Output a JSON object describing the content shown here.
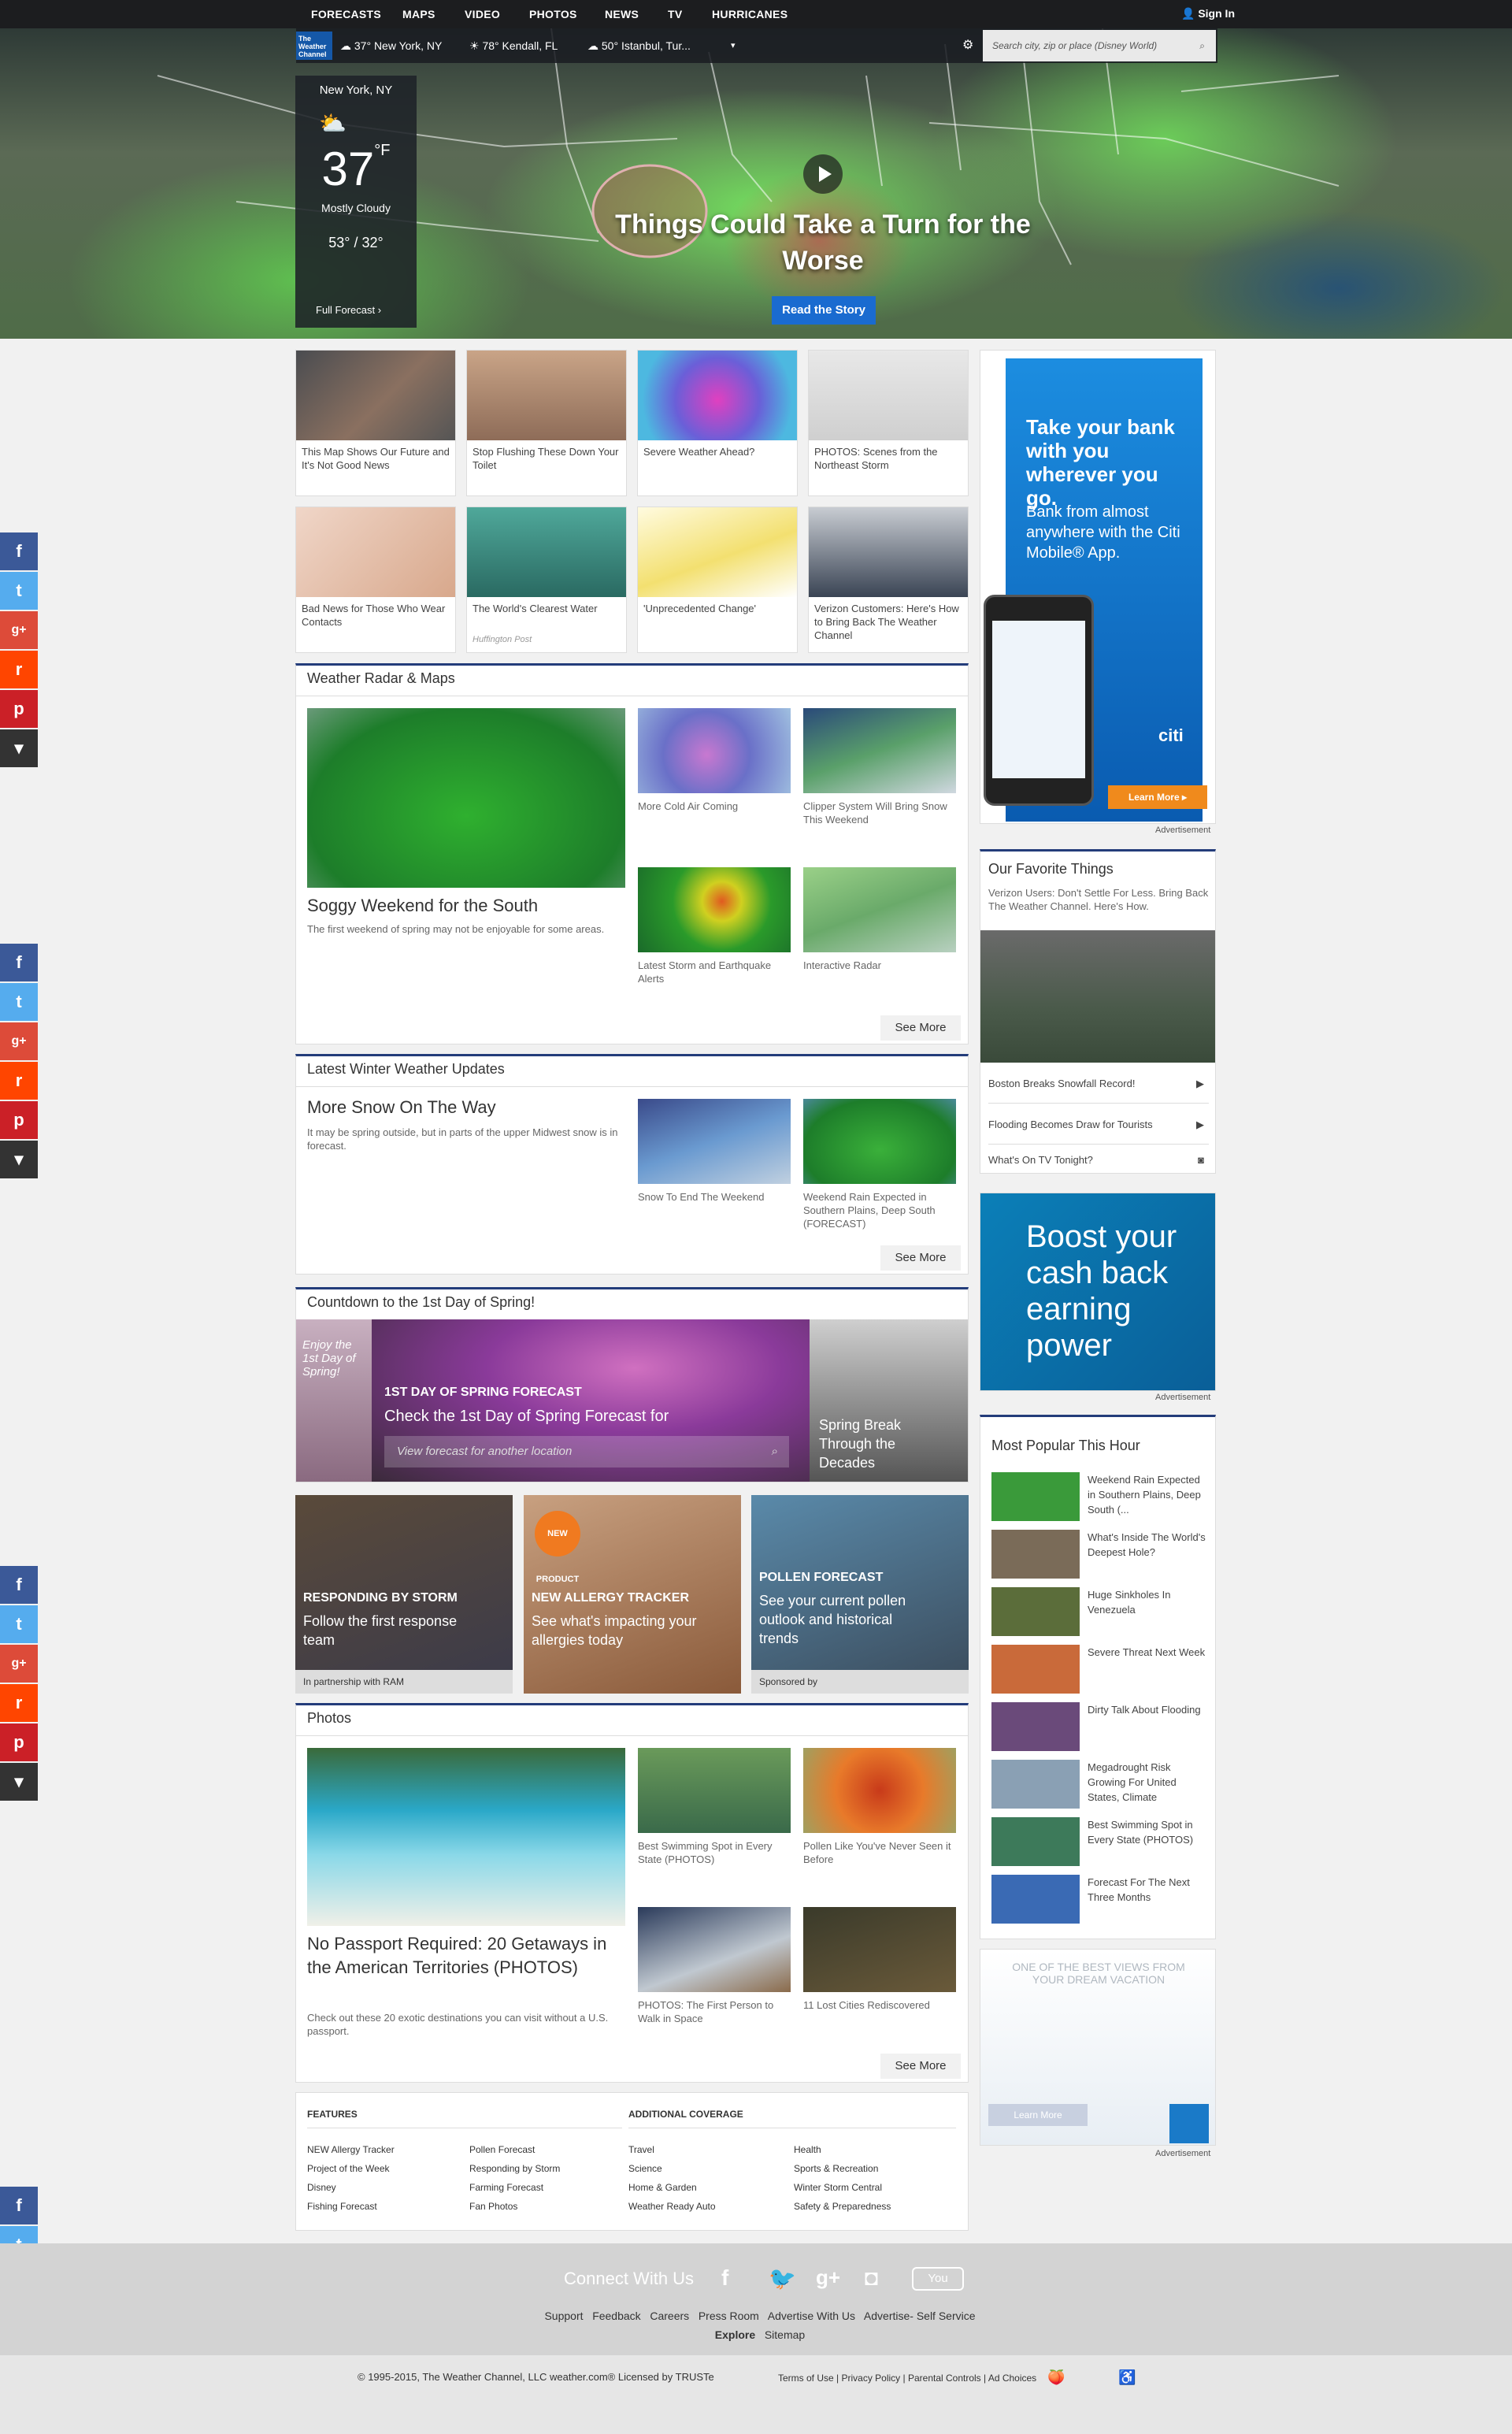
{
  "nav": {
    "items": [
      "FORECASTS",
      "MAPS",
      "VIDEO",
      "PHOTOS",
      "NEWS",
      "TV",
      "HURRICANES"
    ],
    "signin": "Sign In"
  },
  "locbar": {
    "logo": "The Weather Channel",
    "locations": [
      {
        "temp": "37° New York, NY",
        "icon": "cloud-icon"
      },
      {
        "temp": "78° Kendall, FL",
        "icon": "sun-icon"
      },
      {
        "temp": "50° Istanbul, Tur...",
        "icon": "cloud-icon"
      }
    ],
    "search_placeholder": "Search city, zip or place (Disney World)"
  },
  "weather": {
    "city": "New York, NY",
    "temp": "37",
    "unit": "°F",
    "condition": "Mostly Cloudy",
    "hilo": "53° / 32°",
    "link": "Full Forecast"
  },
  "hero": {
    "headline": "Things Could Take a Turn for the Worse",
    "cta": "Read the Story"
  },
  "top_stories": [
    {
      "caption": "This Map Shows Our Future and It's Not Good News",
      "color": "#6d6f72"
    },
    {
      "caption": "Stop Flushing These Down Your Toilet",
      "color": "#a78a6e"
    },
    {
      "caption": "Severe Weather Ahead?",
      "color": "#8a5fb5"
    },
    {
      "caption": "PHOTOS: Scenes from the Northeast Storm",
      "color": "#dcdcdc"
    },
    {
      "caption": "Bad News for Those Who Wear Contacts",
      "color": "#e7c9b8"
    },
    {
      "caption": "The World's Clearest Water",
      "source": "Huffington Post",
      "color": "#3d8a7e"
    },
    {
      "caption": "'Unprecedented Change'",
      "color": "#f0eec8"
    },
    {
      "caption": "Verizon Customers: Here's How to Bring Back The Weather Channel",
      "color": "#50627a"
    }
  ],
  "ad_citi": {
    "title": "Take your bank with you wherever you go.",
    "body": "Bank from almost anywhere with the Citi Mobile® App.",
    "brand": "citi",
    "cta": "Learn More ▸",
    "label": "Advertisement"
  },
  "radar": {
    "title": "Weather Radar & Maps",
    "main_headline": "Soggy Weekend for the South",
    "main_text": "The first weekend of spring may not be enjoyable for some areas.",
    "items": [
      "More Cold Air Coming",
      "Clipper System Will Bring Snow This Weekend",
      "Latest Storm and Earthquake Alerts",
      "Interactive Radar"
    ],
    "see_more": "See More"
  },
  "winter": {
    "title": "Latest Winter Weather Updates",
    "main_headline": "More Snow On The Way",
    "main_text": "It may be spring outside, but in parts of the upper Midwest snow is in forecast.",
    "items": [
      "Snow To End The Weekend",
      "Weekend Rain Expected in Southern Plains, Deep South (FORECAST)"
    ],
    "see_more": "See More"
  },
  "spring": {
    "title": "Countdown to the 1st Day of Spring!",
    "enjoy": "Enjoy the 1st Day of Spring!",
    "label": "1ST DAY OF SPRING FORECAST",
    "sub": "Check the 1st Day of Spring Forecast for",
    "input": "View forecast for another location",
    "side": "Spring Break Through the Decades"
  },
  "tiles": [
    {
      "label": "RESPONDING BY STORM",
      "sub": "Follow the first response team",
      "partner": "In partnership with  RAM"
    },
    {
      "label": "NEW ALLERGY TRACKER",
      "sub": "See what's impacting your allergies today",
      "badge": "NEW PRODUCT"
    },
    {
      "label": "POLLEN FORECAST",
      "sub": "See your current pollen outlook and historical trends",
      "partner": "Sponsored by"
    }
  ],
  "favorites": {
    "title": "Our Favorite Things",
    "promo": "Verizon Users: Don't Settle For Less. Bring Back The Weather Channel. Here's How.",
    "rows": [
      "Boston Breaks Snowfall Record!",
      "Flooding Becomes Draw for Tourists",
      "What's On TV Tonight?"
    ]
  },
  "ad_cash": {
    "text": "Boost your cash back earning power",
    "label": "Advertisement"
  },
  "popular": {
    "title": "Most Popular This Hour",
    "items": [
      {
        "text": "Weekend Rain Expected in Southern Plains, Deep South (...",
        "color": "#3a9a3a"
      },
      {
        "text": "What's Inside The World's Deepest Hole?",
        "color": "#7a6b58"
      },
      {
        "text": "Huge Sinkholes In Venezuela",
        "color": "#5b6d3a"
      },
      {
        "text": "Severe Threat Next Week",
        "color": "#c96a3a"
      },
      {
        "text": "Dirty Talk About Flooding",
        "color": "#6a4a7a"
      },
      {
        "text": "Megadrought Risk Growing For United States, Climate",
        "color": "#8aa0b4"
      },
      {
        "text": "Best Swimming Spot in Every State (PHOTOS)",
        "color": "#3d7a5a"
      },
      {
        "text": "Forecast For The Next Three Months",
        "color": "#3a6ab4"
      }
    ]
  },
  "ad_amex": {
    "text": "ONE OF THE BEST VIEWS FROM YOUR DREAM VACATION",
    "cta": "Learn More",
    "label": "Advertisement"
  },
  "photos": {
    "title": "Photos",
    "main_headline": "No Passport Required: 20 Getaways in the American Territories (PHOTOS)",
    "main_text": "Check out these 20 exotic destinations you can visit without a U.S. passport.",
    "items": [
      "Best Swimming Spot in Every State (PHOTOS)",
      "Pollen Like You've Never Seen it Before",
      "PHOTOS: The First Person to Walk in Space",
      "11 Lost Cities Rediscovered"
    ],
    "see_more": "See More"
  },
  "links": {
    "features_title": "FEATURES",
    "features": [
      "NEW Allergy Tracker",
      "Project of the Week",
      "Disney",
      "Fishing Forecast",
      "Pollen Forecast",
      "Responding by Storm",
      "Farming Forecast",
      "Fan Photos"
    ],
    "coverage_title": "ADDITIONAL COVERAGE",
    "coverage": [
      "Travel",
      "Science",
      "Home & Garden",
      "Weather Ready Auto",
      "Health",
      "Sports & Recreation",
      "Winter Storm Central",
      "Safety & Preparedness"
    ]
  },
  "footer": {
    "connect": "Connect With Us",
    "links": [
      "Support",
      "Feedback",
      "Careers",
      "Press Room",
      "Advertise With Us",
      "Advertise- Self Service"
    ],
    "links2": [
      "Explore",
      "Sitemap"
    ],
    "copyright": "© 1995-2015, The Weather Channel, LLC weather.com® Licensed by TRUSTe",
    "legal": [
      "Terms of Use",
      "Privacy Policy",
      "Parental Controls",
      "Ad Choices"
    ]
  },
  "share": {
    "icons": [
      "f",
      "t",
      "g+",
      "r",
      "p",
      "▾"
    ]
  }
}
